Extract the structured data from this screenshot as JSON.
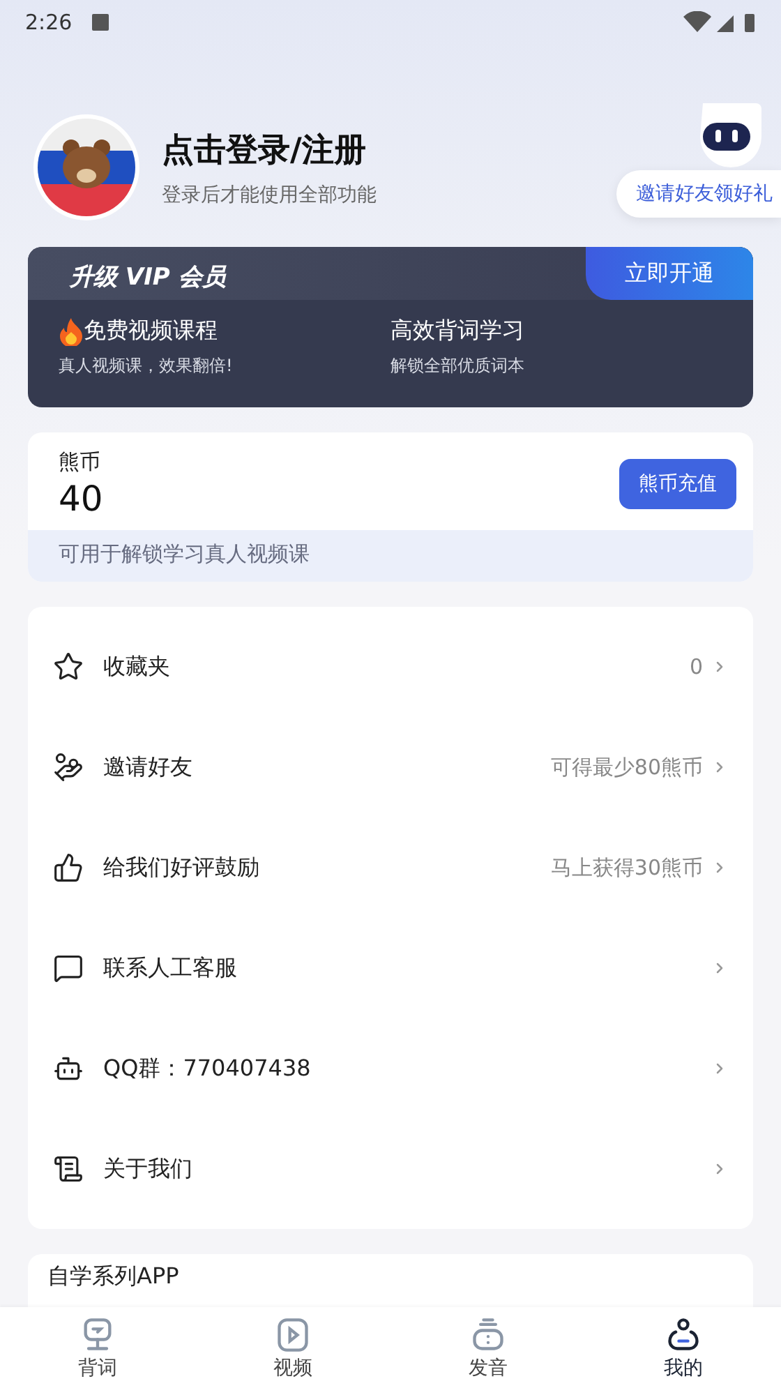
{
  "status_bar": {
    "time": "2:26"
  },
  "profile": {
    "title": "点击登录/注册",
    "subtitle": "登录后才能使用全部功能"
  },
  "invite_badge": {
    "label": "邀请好友领好礼"
  },
  "vip": {
    "title": "升级 VIP 会员",
    "action": "立即开通",
    "features": [
      {
        "title": "免费视频课程",
        "desc": "真人视频课，效果翻倍!",
        "hot": true
      },
      {
        "title": "高效背词学习",
        "desc": "解锁全部优质词本",
        "hot": false
      }
    ]
  },
  "coins": {
    "label": "熊币",
    "amount": "40",
    "action": "熊币充值",
    "note": "可用于解锁学习真人视频课"
  },
  "menu": [
    {
      "kind": "favorites",
      "label": "收藏夹",
      "value": "0"
    },
    {
      "kind": "invite",
      "label": "邀请好友",
      "value": "可得最少80熊币"
    },
    {
      "kind": "rate",
      "label": "给我们好评鼓励",
      "value": "马上获得30熊币"
    },
    {
      "kind": "support",
      "label": "联系人工客服"
    },
    {
      "kind": "qq",
      "label": "QQ群：770407438"
    },
    {
      "kind": "about",
      "label": "关于我们"
    }
  ],
  "apps_section": {
    "title": "自学系列APP"
  },
  "tabs": [
    {
      "kind": "words",
      "label": "背词",
      "selected": false
    },
    {
      "kind": "video",
      "label": "视频",
      "selected": false
    },
    {
      "kind": "pronounce",
      "label": "发音",
      "selected": false
    },
    {
      "kind": "me",
      "label": "我的",
      "selected": true
    }
  ]
}
